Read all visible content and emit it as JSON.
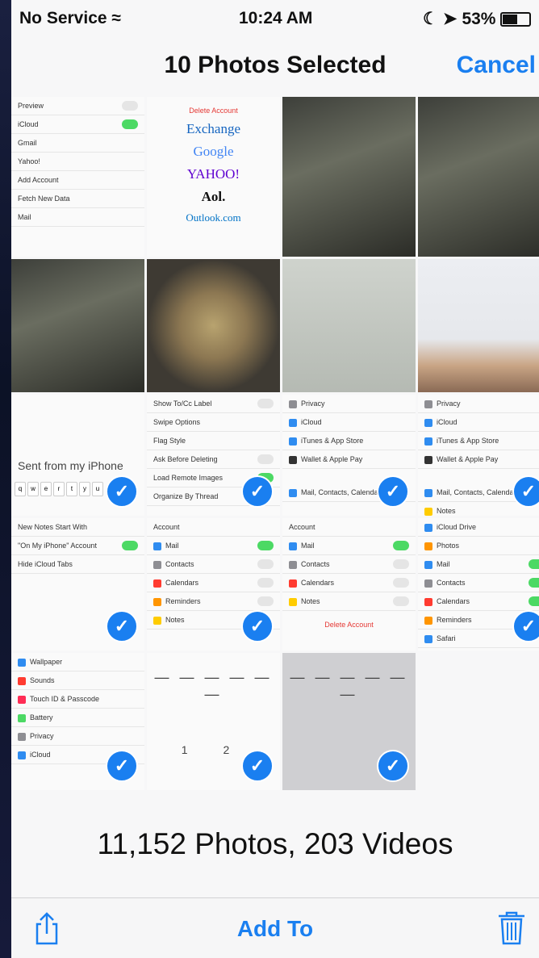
{
  "status": {
    "carrier": "No Service",
    "time": "10:24 AM",
    "battery": "53%",
    "battery_level": 0.53
  },
  "nav": {
    "title": "10 Photos Selected",
    "cancel_label": "Cancel"
  },
  "grid": {
    "cells": [
      {
        "kind": "mail-settings"
      },
      {
        "kind": "add-account",
        "logos": [
          "Exchange",
          "Google",
          "YAHOO!",
          "Aol.",
          "Outlook.com"
        ]
      },
      {
        "kind": "photo-dark"
      },
      {
        "kind": "photo-dark"
      },
      {
        "kind": "photo-dark"
      },
      {
        "kind": "photo-rust"
      },
      {
        "kind": "photo-screen"
      },
      {
        "kind": "photo-hand"
      }
    ],
    "selected_count": 10
  },
  "texts": {
    "sent_from": "Sent from my iPhone",
    "delete_account": "Delete Account"
  },
  "footer": {
    "count": "11,152 Photos, 203 Videos"
  },
  "toolbar": {
    "add_to_label": "Add To"
  },
  "colors": {
    "accent": "#1a7ff0",
    "switch_on": "#4cd964"
  },
  "icons": {
    "share": "share-icon",
    "trash": "trash-icon",
    "check": "checkmark-icon"
  }
}
